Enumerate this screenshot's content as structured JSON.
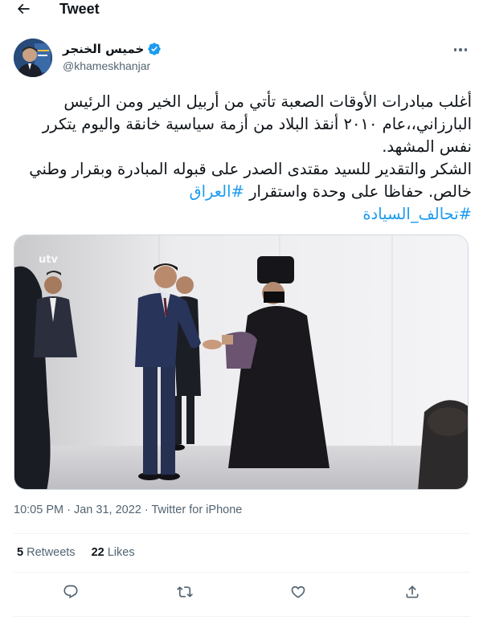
{
  "header": {
    "title": "Tweet",
    "back_icon": "arrow-left-icon"
  },
  "author": {
    "display_name": "خميس الخنجر",
    "handle": "@khameskhanjar",
    "verified_icon": "verified-badge-icon",
    "more_icon": "more-dots-icon"
  },
  "tweet": {
    "paragraph_1": "أغلب مبادرات الأوقات الصعبة تأتي من أربيل الخير ومن الرئيس البارزاني،،عام ٢٠١٠ أنقذ البلاد من أزمة سياسية خانقة واليوم يتكرر نفس المشهد.",
    "paragraph_2": "الشكر والتقدير للسيد مقتدى الصدر على قبوله المبادرة وبقرار وطني خالص. حفاظا على وحدة واستقرار",
    "hashtag_1": "#العراق",
    "hashtag_2": "#تحالف_السيادة",
    "media_logo": "utv"
  },
  "meta": {
    "time": "10:05 PM",
    "separator": "·",
    "date": "Jan 31, 2022",
    "source": "Twitter for iPhone"
  },
  "stats": {
    "retweets_count": "5",
    "retweets_label": "Retweets",
    "likes_count": "22",
    "likes_label": "Likes"
  },
  "actions": {
    "reply_icon": "reply-icon",
    "retweet_icon": "retweet-icon",
    "like_icon": "heart-icon",
    "share_icon": "share-icon"
  },
  "colors": {
    "accent": "#1d9bf0",
    "text": "#0f1419",
    "secondary": "#536471",
    "divider": "#eff3f4"
  }
}
